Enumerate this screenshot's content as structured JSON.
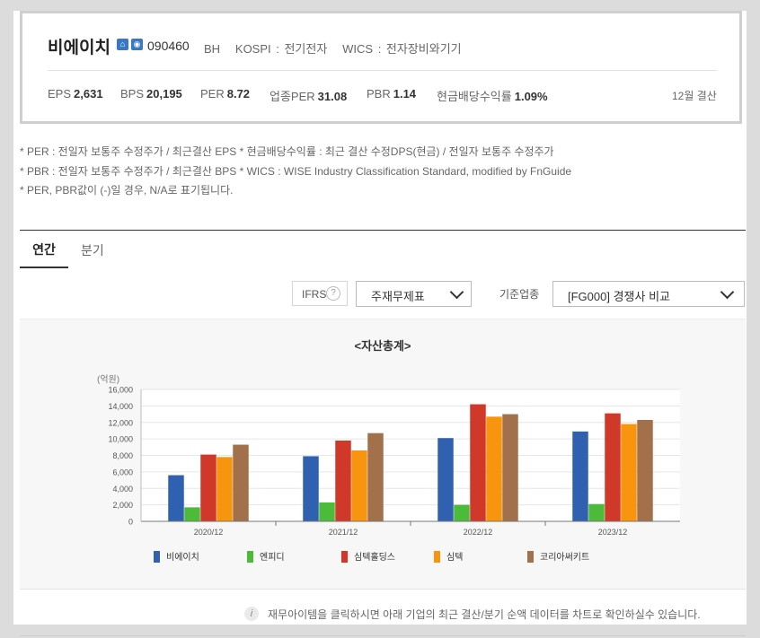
{
  "company": {
    "name": "비에이치",
    "code": "090460",
    "market_info": "BH   KOSPI : 전기전자   WICS : 전자장비와기기"
  },
  "metrics": [
    {
      "label": "EPS",
      "value": "2,631"
    },
    {
      "label": "BPS",
      "value": "20,195"
    },
    {
      "label": "PER",
      "value": "8.72"
    },
    {
      "label": "업종PER",
      "value": "31.08"
    },
    {
      "label": "PBR",
      "value": "1.14"
    },
    {
      "label": "현금배당수익률",
      "value": "1.09%"
    }
  ],
  "fiscal_month": "12월 결산",
  "notes": [
    "* PER : 전일자 보통주 수정주가 / 최근결산 EPS * 현금배당수익률 : 최근 결산 수정DPS(현금) / 전일자 보통주 수정주가",
    "* PBR : 전일자 보통주 수정주가 / 최근결산 BPS * WICS : WISE Industry Classification Standard, modified by FnGuide",
    "* PER, PBR값이 (-)일 경우, N/A로 표기됩니다."
  ],
  "tabs": {
    "annual": "연간",
    "quarter": "분기"
  },
  "controls": {
    "ifrs_label": "IFRS",
    "help_glyph": "?",
    "statement_select": "주재무제표",
    "industry_label": "기준업종",
    "industry_select": "[FG000] 경쟁사 비교"
  },
  "chart_data": {
    "type": "bar",
    "title": "<자산총계>",
    "ylabel": "(억원)",
    "categories": [
      "2020/12",
      "2021/12",
      "2022/12",
      "2023/12"
    ],
    "ylim": [
      0,
      16000
    ],
    "yticks": [
      "16,000",
      "14,000",
      "12,000",
      "10,000",
      "8,000",
      "6,000",
      "4,000",
      "2,000",
      "0"
    ],
    "grid": true,
    "legend_position": "bottom",
    "series": [
      {
        "name": "비에이치",
        "color": "#3060b0",
        "values": [
          5600,
          7900,
          10100,
          10900
        ]
      },
      {
        "name": "엔피디",
        "color": "#4cbb3a",
        "values": [
          1700,
          2300,
          2000,
          2100
        ]
      },
      {
        "name": "심텍홀딩스",
        "color": "#d0392a",
        "values": [
          8100,
          9800,
          14200,
          13100
        ]
      },
      {
        "name": "심텍",
        "color": "#f7960e",
        "values": [
          7800,
          8600,
          12700,
          11800
        ]
      },
      {
        "name": "코리아써키트",
        "color": "#a2704a",
        "values": [
          9300,
          10700,
          13000,
          12300
        ]
      }
    ]
  },
  "footer": {
    "info_glyph": "i",
    "text": "재무아이템을 클릭하시면 아래 기업의 최근 결산/분기 순액 데이터를 차트로 확인하실수 있습니다."
  }
}
